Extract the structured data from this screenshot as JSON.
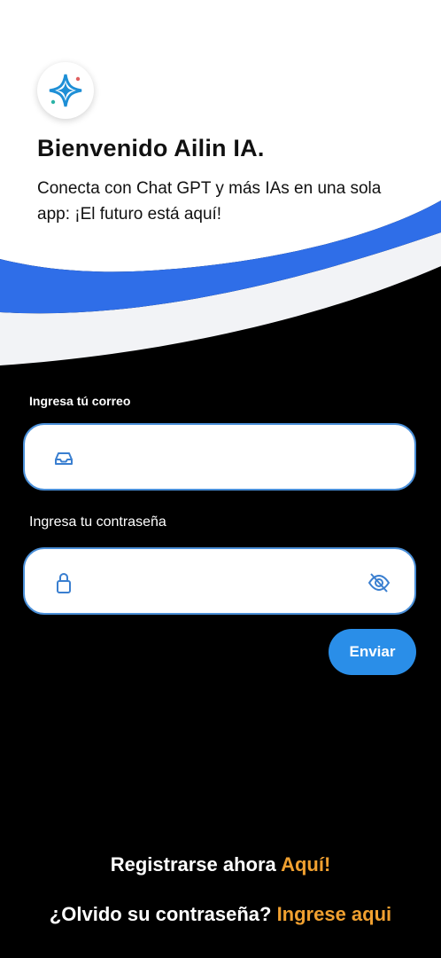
{
  "header": {
    "title": "Bienvenido Ailin IA.",
    "subtitle": "Conecta con Chat GPT y más IAs en una sola app: ¡El futuro está aquí!",
    "logo_icon": "ailin-star-logo-icon"
  },
  "form": {
    "email_label": "Ingresa tú correo",
    "email_value": "",
    "email_icon": "inbox-tray-icon",
    "password_label": "Ingresa tu contraseña",
    "password_value": "",
    "password_icon": "lock-icon",
    "password_toggle_icon": "eye-off-icon",
    "submit_label": "Enviar"
  },
  "footer": {
    "register_text": "Registrarse ahora",
    "register_link": "Aquí!",
    "forgot_text": "¿Olvido su contraseña?",
    "forgot_link": "Ingrese aqui"
  },
  "colors": {
    "background": "#000000",
    "wave_blue": "#2f6ee8",
    "accent_blue": "#2a8ee8",
    "link_orange": "#f0a030",
    "field_border": "#4a8fd8"
  }
}
